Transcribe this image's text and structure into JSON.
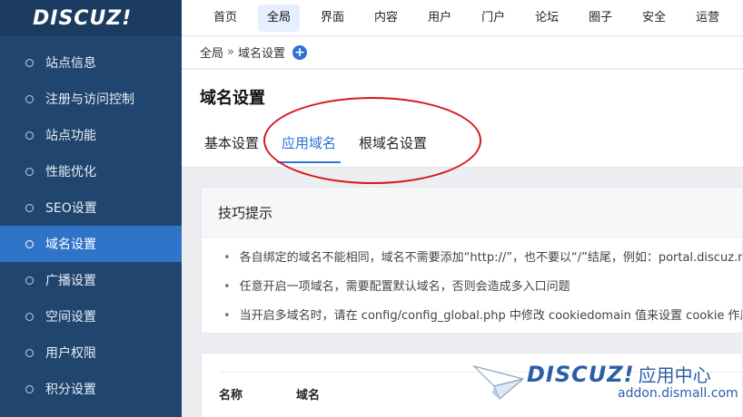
{
  "logo": {
    "text": "DISCUZ!"
  },
  "topnav": {
    "items": [
      {
        "label": "首页"
      },
      {
        "label": "全局"
      },
      {
        "label": "界面"
      },
      {
        "label": "内容"
      },
      {
        "label": "用户"
      },
      {
        "label": "门户"
      },
      {
        "label": "论坛"
      },
      {
        "label": "圈子"
      },
      {
        "label": "安全"
      },
      {
        "label": "运营"
      }
    ],
    "active_index": 1
  },
  "sidebar": {
    "items": [
      {
        "label": "站点信息"
      },
      {
        "label": "注册与访问控制"
      },
      {
        "label": "站点功能"
      },
      {
        "label": "性能优化"
      },
      {
        "label": "SEO设置"
      },
      {
        "label": "域名设置"
      },
      {
        "label": "广播设置"
      },
      {
        "label": "空间设置"
      },
      {
        "label": "用户权限"
      },
      {
        "label": "积分设置"
      }
    ],
    "active_index": 5
  },
  "breadcrumb": {
    "root": "全局",
    "separator": "»",
    "current": "域名设置",
    "add_symbol": "+"
  },
  "page": {
    "title": "域名设置",
    "tabs": [
      {
        "label": "基本设置"
      },
      {
        "label": "应用域名"
      },
      {
        "label": "根域名设置"
      }
    ],
    "active_tab": 1
  },
  "tips": {
    "title": "技巧提示",
    "bullet": "•",
    "items": [
      "各自绑定的域名不能相同，域名不需要添加“http://”，也不要以“/”结尾，例如：portal.discuz.net",
      "任意开启一项域名，需要配置默认域名，否则会造成多入口问题",
      "当开启多域名时，请在 config/config_global.php 中修改 cookiedomain 值来设置 cookie 作用域"
    ]
  },
  "table": {
    "headers": [
      "名称",
      "域名"
    ]
  },
  "watermark": {
    "brand": "DISCUZ!",
    "suffix": "应用中心",
    "url": "addon.dismall.com"
  },
  "colors": {
    "sidebar_bg": "#20456e",
    "sidebar_active": "#2f74c8",
    "accent": "#2b73d6",
    "annotation": "#d6181c"
  }
}
